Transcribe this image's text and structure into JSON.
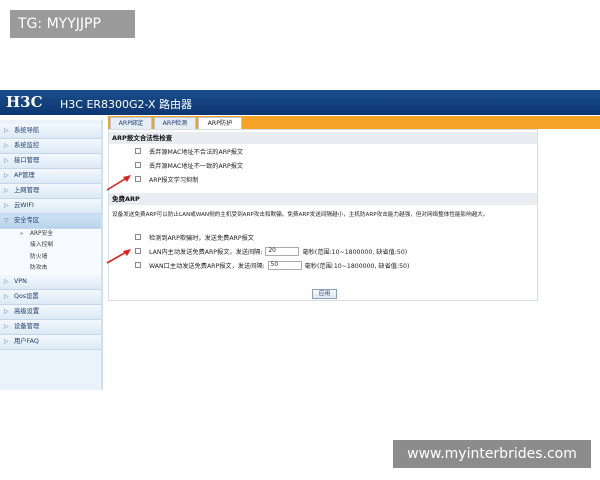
{
  "watermarks": {
    "top_left": "TG: MYYJJPP",
    "bottom_right": "www.myinterbrides.com"
  },
  "header": {
    "logo": "H3C",
    "product_title": "H3C ER8300G2-X 路由器"
  },
  "nav": {
    "items": [
      {
        "label": "系统导航",
        "arrow": "▷"
      },
      {
        "label": "系统监控",
        "arrow": "▷"
      },
      {
        "label": "接口管理",
        "arrow": "▷"
      },
      {
        "label": "AP管理",
        "arrow": "▷"
      },
      {
        "label": "上网管理",
        "arrow": "▷"
      },
      {
        "label": "云WIFI",
        "arrow": "▷"
      },
      {
        "label": "安全专区",
        "arrow": "▽"
      }
    ],
    "sub_items": [
      {
        "label": "ARP安全",
        "arrow": "»"
      },
      {
        "label": "接入控制"
      },
      {
        "label": "防火墙"
      },
      {
        "label": "防攻击"
      }
    ],
    "items_after": [
      {
        "label": "VPN",
        "arrow": "▷"
      },
      {
        "label": "Qos设置",
        "arrow": "▷"
      },
      {
        "label": "高级设置",
        "arrow": "▷"
      },
      {
        "label": "设备管理",
        "arrow": "▷"
      },
      {
        "label": "用户FAQ",
        "arrow": "▷"
      }
    ]
  },
  "tabs": [
    {
      "label": "ARP绑定",
      "active": false
    },
    {
      "label": "ARP检测",
      "active": false
    },
    {
      "label": "ARP防护",
      "active": true
    }
  ],
  "section1": {
    "title": "ARP报文合法性检查",
    "options": [
      {
        "label": "丢弃源MAC地址不合法的ARP报文",
        "checked": false
      },
      {
        "label": "丢弃源MAC地址不一致的ARP报文",
        "checked": false
      },
      {
        "label": "ARP报文学习抑制",
        "checked": false
      }
    ]
  },
  "section2": {
    "title": "免费ARP",
    "description": "设备发送免费ARP可以防止LAN或WAN侧的主机受到ARP攻击和欺骗。免费ARP发送间隔越小，主机防ARP攻击能力越强，但对网络整体性能影响越大。",
    "option_detect": {
      "label": "检测到ARP欺骗时，发送免费ARP报文",
      "checked": false
    },
    "option_lan": {
      "label": "LAN内主动发送免费ARP报文，发送间隔:",
      "value": "20",
      "unit": "毫秒(范围:10~1800000, 缺省值:50)",
      "checked": false
    },
    "option_wan": {
      "label": "WAN口主动发送免费ARP报文，发送间隔:",
      "value": "50",
      "unit": "毫秒(范围:10~1800000, 缺省值:50)",
      "checked": false
    },
    "apply_label": "应用"
  },
  "colors": {
    "header_blue": "#0c3670",
    "tab_orange": "#f4a326",
    "annotation_red": "#e0201c"
  }
}
